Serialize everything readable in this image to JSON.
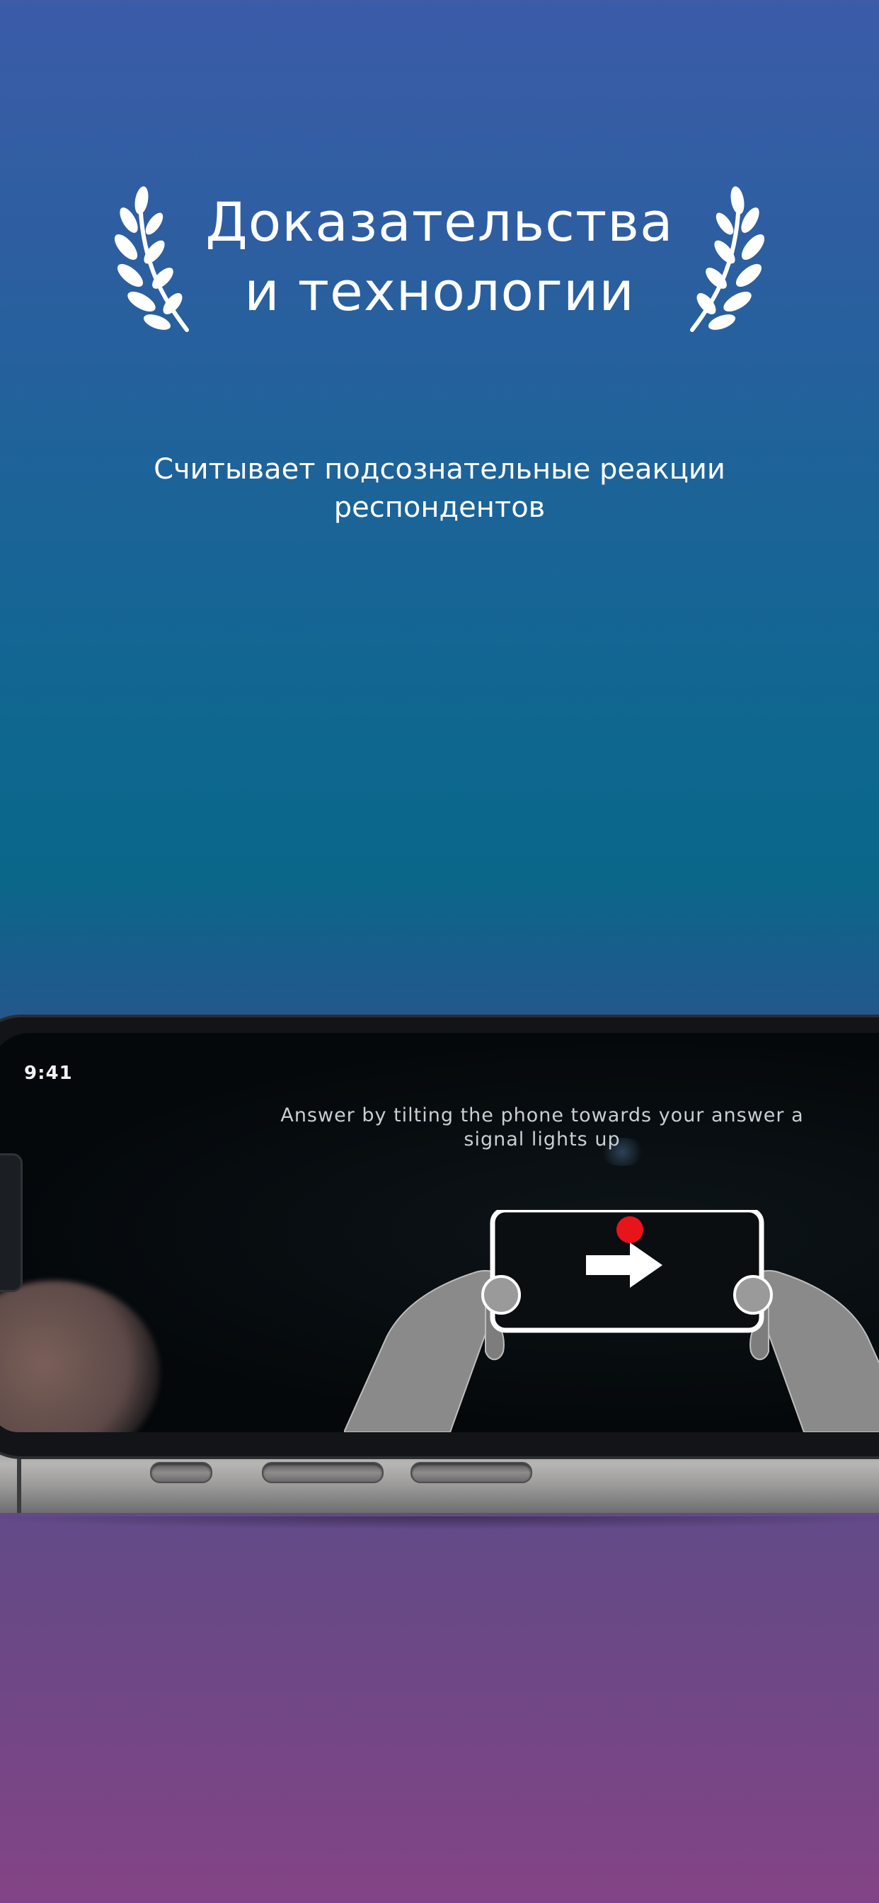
{
  "headline": {
    "line1": "Доказательства",
    "line2": "и технологии"
  },
  "subtitle": {
    "line1": "Считывает подсознательные реакции",
    "line2": "респондентов"
  },
  "phone_screen": {
    "status_time": "9:41",
    "instruction_line1": "Answer by tilting the phone towards your answer a",
    "instruction_line2": "signal lights up",
    "signal_color": "#e8141b",
    "arrow_icon": "arrow-right-icon"
  },
  "colors": {
    "background_top": "#3b5ca8",
    "background_mid": "#0a678a",
    "background_bottom": "#834485",
    "text": "#ffffff"
  }
}
